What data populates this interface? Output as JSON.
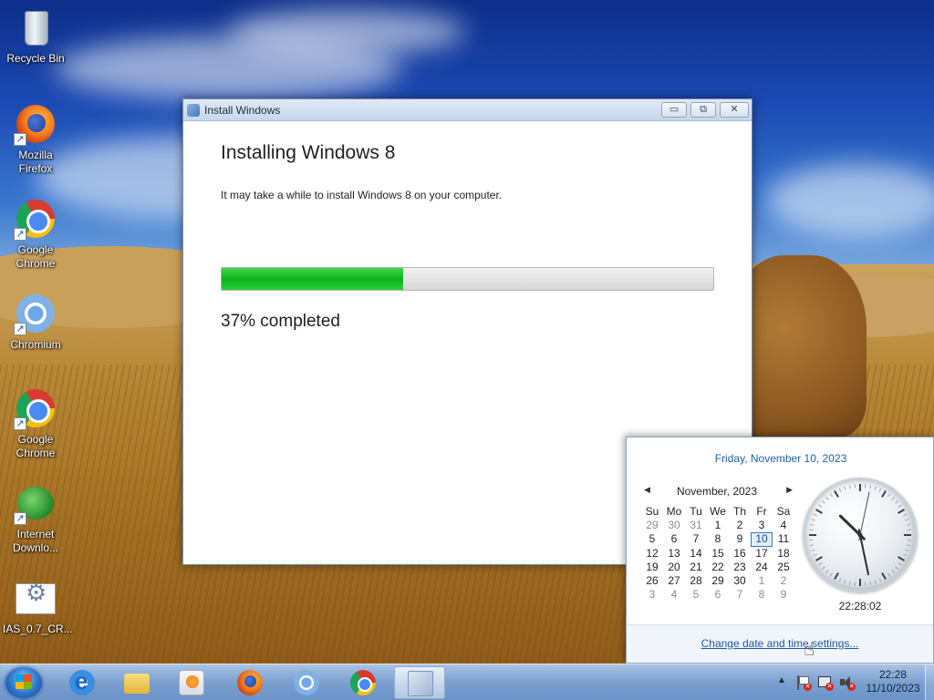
{
  "desktop": {
    "icons": [
      {
        "label": "Recycle Bin"
      },
      {
        "label": "Mozilla Firefox"
      },
      {
        "label": "Google Chrome"
      },
      {
        "label": "Chromium"
      },
      {
        "label": "Google Chrome"
      },
      {
        "label": "Internet Downlo..."
      },
      {
        "label": "IAS_0.7_CR..."
      }
    ]
  },
  "install_window": {
    "title": "Install Windows",
    "heading": "Installing Windows 8",
    "subtext": "It may take a while to install Windows 8 on your computer.",
    "progress_percent": 37,
    "progress_text": "37% completed",
    "buttons": {
      "minimize": "▭",
      "restore": "⧉",
      "close": "✕"
    }
  },
  "clock_flyout": {
    "full_date": "Friday, November 10, 2023",
    "month_title": "November, 2023",
    "prev_glyph": "◀",
    "next_glyph": "▶",
    "weekdays": [
      "Su",
      "Mo",
      "Tu",
      "We",
      "Th",
      "Fr",
      "Sa"
    ],
    "weeks": [
      [
        {
          "d": "29",
          "o": true
        },
        {
          "d": "30",
          "o": true
        },
        {
          "d": "31",
          "o": true
        },
        {
          "d": "1"
        },
        {
          "d": "2"
        },
        {
          "d": "3"
        },
        {
          "d": "4"
        }
      ],
      [
        {
          "d": "5"
        },
        {
          "d": "6"
        },
        {
          "d": "7"
        },
        {
          "d": "8"
        },
        {
          "d": "9"
        },
        {
          "d": "10",
          "t": true
        },
        {
          "d": "11"
        }
      ],
      [
        {
          "d": "12"
        },
        {
          "d": "13"
        },
        {
          "d": "14"
        },
        {
          "d": "15"
        },
        {
          "d": "16"
        },
        {
          "d": "17"
        },
        {
          "d": "18"
        }
      ],
      [
        {
          "d": "19"
        },
        {
          "d": "20"
        },
        {
          "d": "21"
        },
        {
          "d": "22"
        },
        {
          "d": "23"
        },
        {
          "d": "24"
        },
        {
          "d": "25"
        }
      ],
      [
        {
          "d": "26"
        },
        {
          "d": "27"
        },
        {
          "d": "28"
        },
        {
          "d": "29"
        },
        {
          "d": "30"
        },
        {
          "d": "1",
          "o": true
        },
        {
          "d": "2",
          "o": true
        }
      ],
      [
        {
          "d": "3",
          "o": true
        },
        {
          "d": "4",
          "o": true
        },
        {
          "d": "5",
          "o": true
        },
        {
          "d": "6",
          "o": true
        },
        {
          "d": "7",
          "o": true
        },
        {
          "d": "8",
          "o": true
        },
        {
          "d": "9",
          "o": true
        }
      ]
    ],
    "analog_time": {
      "hours": 22,
      "minutes": 28,
      "seconds": 2
    },
    "digital_time": "22:28:02",
    "settings_link": "Change date and time settings..."
  },
  "taskbar": {
    "pinned": [
      {
        "icon": "internet-explorer-icon"
      },
      {
        "icon": "windows-explorer-icon"
      },
      {
        "icon": "media-player-icon"
      },
      {
        "icon": "firefox-icon"
      },
      {
        "icon": "chromium-icon"
      },
      {
        "icon": "chrome-icon"
      },
      {
        "icon": "setup-icon",
        "active": true
      }
    ],
    "tray": {
      "expand_glyph": "▲",
      "time": "22:28",
      "date": "11/10/2023"
    }
  },
  "colors": {
    "accent_link": "#1c57a8",
    "progress_green": "#0fb21f",
    "flyout_date": "#1f5fa8"
  }
}
